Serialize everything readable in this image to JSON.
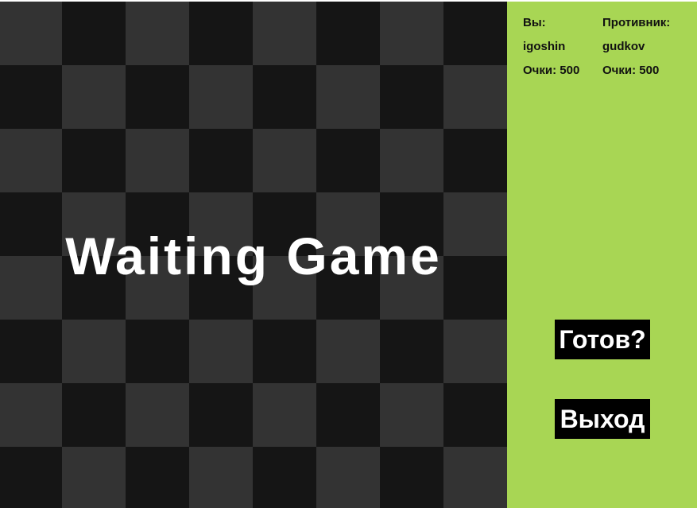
{
  "colors": {
    "board_dark": "#151515",
    "board_light": "#333333",
    "sidebar": "#a8d654",
    "button_bg": "#000000",
    "button_text": "#ffffff",
    "title_text": "#ffffff"
  },
  "board": {
    "title": "Waiting Game"
  },
  "player": {
    "heading": "Вы:",
    "name": "igoshin",
    "score": "Очки: 500"
  },
  "opponent": {
    "heading": "Противник:",
    "name": "gudkov",
    "score": "Очки: 500"
  },
  "buttons": {
    "ready": "Готов?",
    "exit": "Выход"
  }
}
